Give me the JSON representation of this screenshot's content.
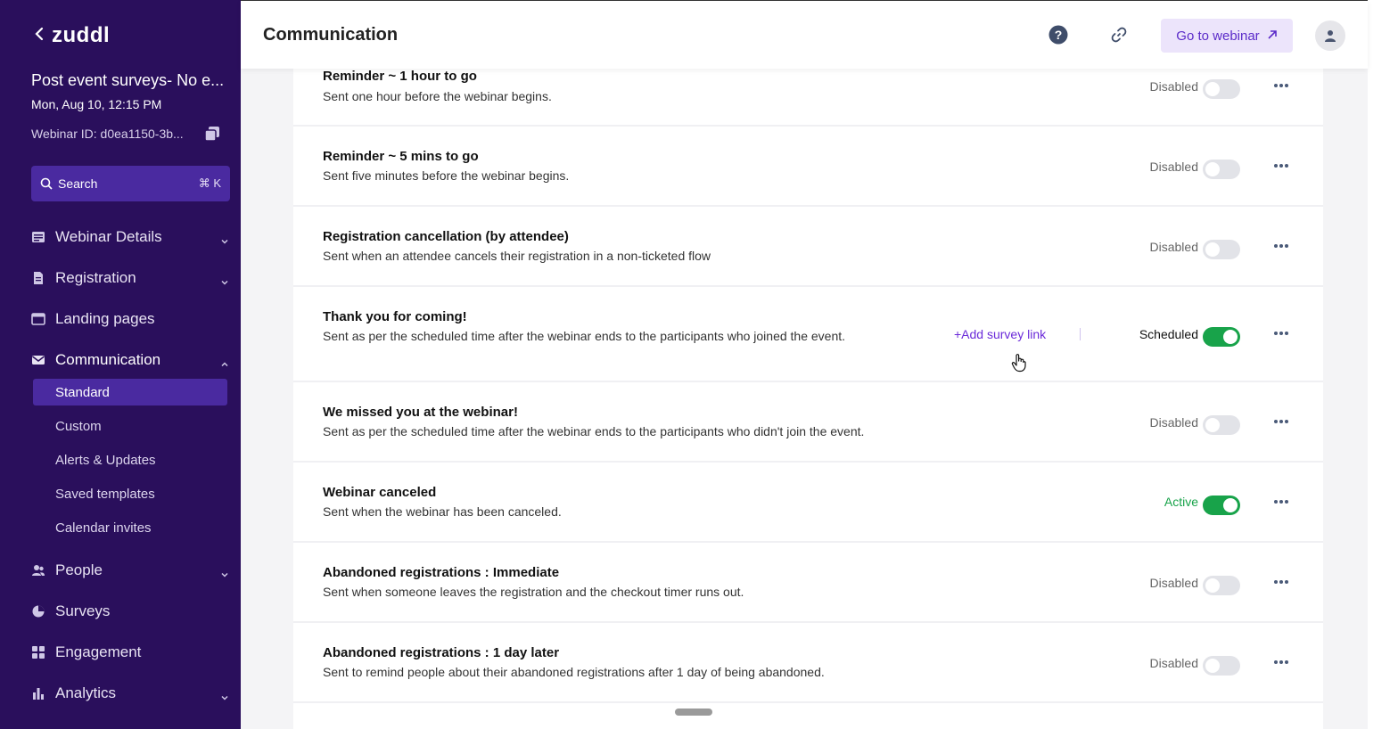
{
  "sidebar": {
    "brand": "zuddl",
    "event_title": "Post event surveys- No e...",
    "event_date": "Mon, Aug 10, 12:15 PM",
    "webinar_id": "Webinar ID: d0ea1150-3b...",
    "search_label": "Search",
    "search_shortcut": "⌘ K",
    "nav": [
      {
        "label": "Webinar Details"
      },
      {
        "label": "Registration"
      },
      {
        "label": "Landing pages"
      },
      {
        "label": "Communication"
      },
      {
        "label": "People"
      },
      {
        "label": "Surveys"
      },
      {
        "label": "Engagement"
      },
      {
        "label": "Analytics"
      }
    ],
    "communication_sub": [
      {
        "label": "Standard"
      },
      {
        "label": "Custom"
      },
      {
        "label": "Alerts & Updates"
      },
      {
        "label": "Saved templates"
      },
      {
        "label": "Calendar invites"
      }
    ]
  },
  "header": {
    "title": "Communication",
    "goto_label": "Go to webinar"
  },
  "rows": [
    {
      "title": "Reminder ~ 1 hour to go",
      "desc": "Sent one hour before the webinar begins.",
      "status": "Disabled",
      "enabled": false
    },
    {
      "title": "Reminder ~ 5 mins to go",
      "desc": "Sent five minutes before the webinar begins.",
      "status": "Disabled",
      "enabled": false
    },
    {
      "title": "Registration cancellation (by attendee)",
      "desc": "Sent when an attendee cancels their registration in a non-ticketed flow",
      "status": "Disabled",
      "enabled": false
    },
    {
      "title": "Thank you for coming!",
      "desc": "Sent as per the scheduled time after the webinar ends to the participants who joined the event.",
      "status": "Scheduled",
      "enabled": true,
      "survey_link": "+Add survey link"
    },
    {
      "title": "We missed you at the webinar!",
      "desc": "Sent as per the scheduled time after the webinar ends to the participants who didn't join the event.",
      "status": "Disabled",
      "enabled": false
    },
    {
      "title": "Webinar canceled",
      "desc": "Sent when the webinar has been canceled.",
      "status": "Active",
      "enabled": true
    },
    {
      "title": "Abandoned registrations : Immediate",
      "desc": "Sent when someone leaves the registration and the checkout timer runs out.",
      "status": "Disabled",
      "enabled": false
    },
    {
      "title": "Abandoned registrations : 1 day later",
      "desc": "Sent to remind people about their abandoned registrations after 1 day of being abandoned.",
      "status": "Disabled",
      "enabled": false
    }
  ],
  "colors": {
    "sidebar_bg": "#2a0f5c",
    "accent": "#5b2bc9",
    "active_green": "#18a34a"
  }
}
